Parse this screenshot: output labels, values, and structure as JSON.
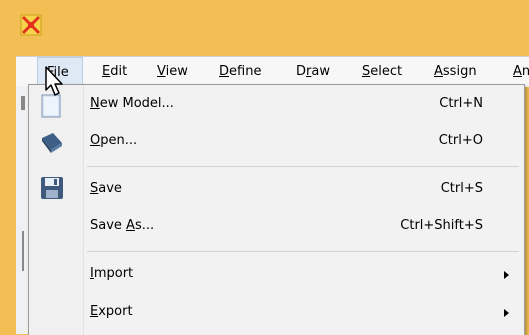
{
  "menubar": {
    "items": [
      {
        "label": "File",
        "accel": "F",
        "rest": "ile"
      },
      {
        "label": "Edit",
        "accel": "E",
        "rest": "dit"
      },
      {
        "label": "View",
        "accel": "V",
        "rest": "iew"
      },
      {
        "label": "Define",
        "accel": "D",
        "rest": "efine"
      },
      {
        "pre": "D",
        "accel": "r",
        "rest": "aw",
        "label": "Draw"
      },
      {
        "label": "Select",
        "accel": "S",
        "rest": "elect"
      },
      {
        "label": "Assign",
        "accel": "A",
        "rest": "ssign"
      },
      {
        "label": "An",
        "accel": "A",
        "rest": "n"
      }
    ]
  },
  "file_menu": {
    "items": [
      {
        "pre": "",
        "accel": "N",
        "rest": "ew Model...",
        "shortcut": "Ctrl+N"
      },
      {
        "pre": "",
        "accel": "O",
        "rest": "pen...",
        "shortcut": "Ctrl+O"
      },
      {
        "pre": "",
        "accel": "S",
        "rest": "ave",
        "shortcut": "Ctrl+S"
      },
      {
        "pre": "Save ",
        "accel": "A",
        "rest": "s...",
        "shortcut": "Ctrl+Shift+S"
      },
      {
        "pre": "",
        "accel": "I",
        "rest": "mport",
        "shortcut": ""
      },
      {
        "pre": "",
        "accel": "E",
        "rest": "xport",
        "shortcut": ""
      }
    ]
  },
  "colors": {
    "title_bar": "#f3bf55",
    "menu_background": "#f2f2f2",
    "menu_highlight": "#dfe9f5"
  },
  "icons": [
    "app-logo-icon",
    "new-document-icon",
    "open-icon",
    "save-floppy-icon",
    "submenu-arrow-icon",
    "mouse-cursor-icon"
  ]
}
